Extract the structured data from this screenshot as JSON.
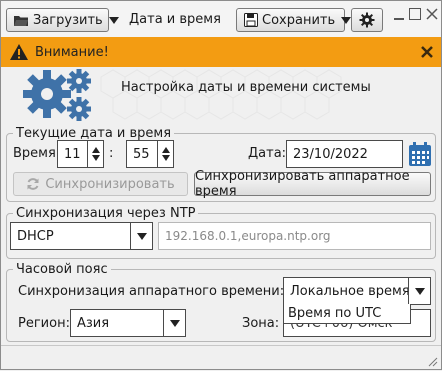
{
  "toolbar": {
    "load_label": "Загрузить",
    "title": "Дата и время",
    "save_label": "Сохранить"
  },
  "warning": {
    "label": "Внимание!",
    "color": "#f39c12"
  },
  "header": {
    "title": "Настройка даты и времени системы"
  },
  "current": {
    "legend": "Текущие дата и время",
    "time_label": "Время:",
    "hours": "11",
    "minutes": "55",
    "separator": ":",
    "date_label": "Дата:",
    "date": "23/10/2022",
    "sync_label": "Синхронизировать",
    "hw_sync_label": "Синхронизировать аппаратное время"
  },
  "ntp": {
    "legend": "Синхронизация через NTP",
    "mode": "DHCP",
    "servers": "192.168.0.1,europa.ntp.org"
  },
  "timezone": {
    "legend": "Часовой пояс",
    "hw_label": "Синхронизация аппаратного времени:",
    "hw_value": "Локальное время",
    "hw_options": [
      "Время по UTC"
    ],
    "region_label": "Регион:",
    "region_value": "Азия",
    "zone_label": "Зона:",
    "zone_value": "(UTC+06) Омск"
  },
  "icons": {
    "load": "chevron-down-icon",
    "save": "floppy-disk-icon",
    "settings": "gear-icon",
    "warning": "warning-triangle-icon",
    "calendar": "calendar-icon",
    "sync": "refresh-icon"
  }
}
